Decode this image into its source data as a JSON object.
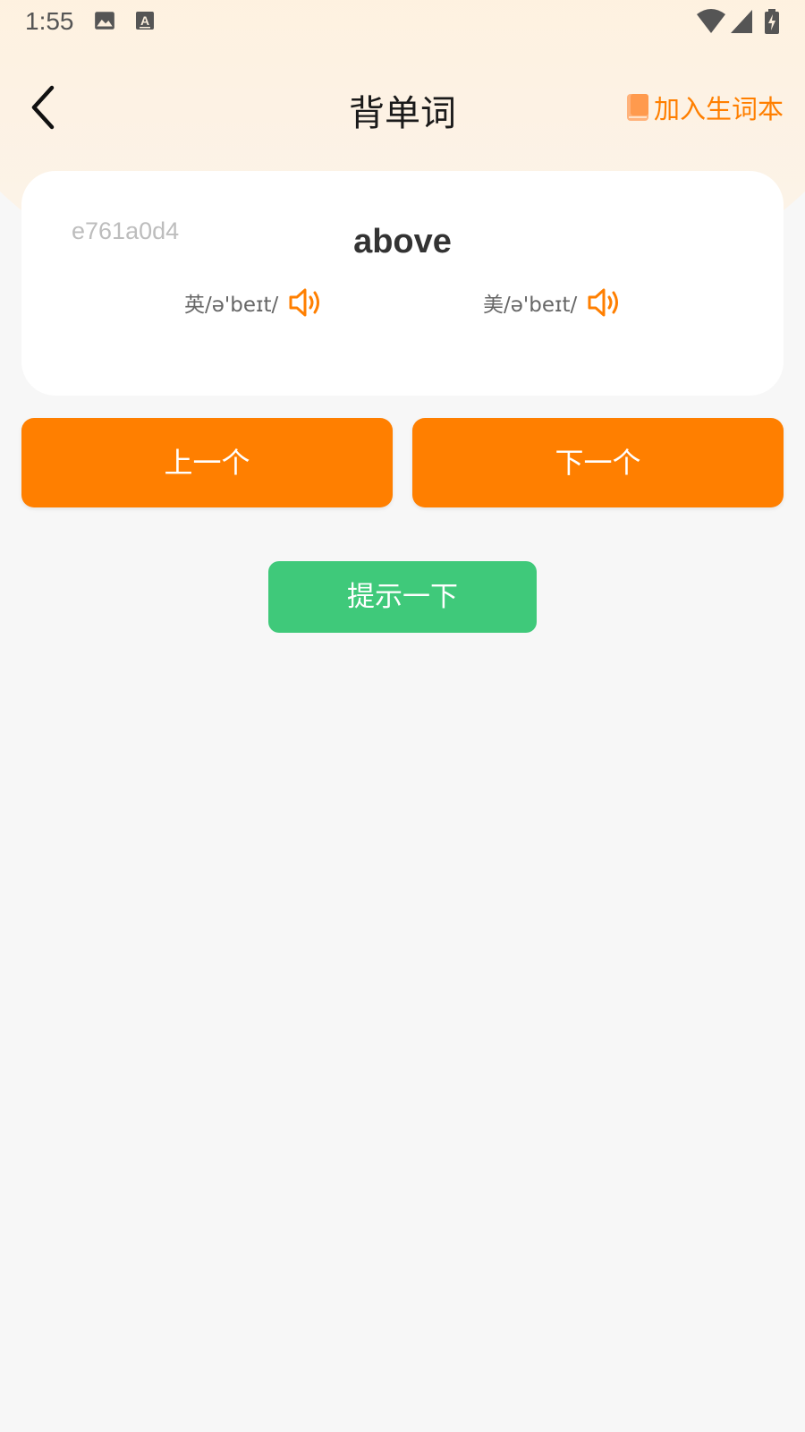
{
  "status_bar": {
    "time": "1:55",
    "icons": [
      "image-icon",
      "keyboard-a-icon",
      "wifi-icon",
      "signal-icon",
      "battery-charging-icon"
    ]
  },
  "nav": {
    "title": "背单词",
    "back_icon": "chevron-left-icon",
    "add_vocab_label": "加入生词本",
    "add_vocab_icon": "book-icon"
  },
  "card": {
    "id_text": "e761a0d4",
    "word": "above",
    "uk_phonetic": "英/ə'beɪt/",
    "us_phonetic": "美/ə'beɪt/"
  },
  "buttons": {
    "prev_label": "上一个",
    "next_label": "下一个",
    "hint_label": "提示一下"
  },
  "colors": {
    "accent_orange": "#ff7f00",
    "hint_green": "#3fc97a",
    "header_gradient_top": "#fde7c8",
    "background": "#f7f7f7"
  }
}
